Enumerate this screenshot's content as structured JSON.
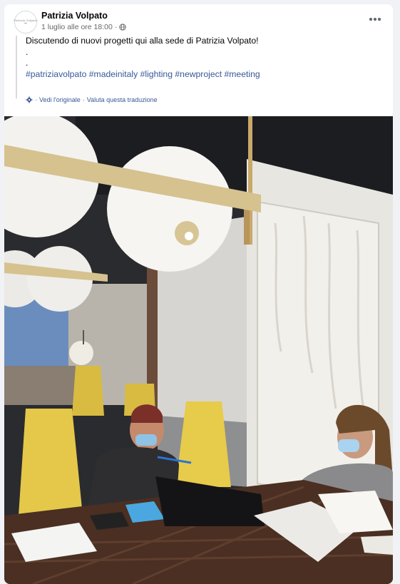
{
  "post": {
    "author": "Patrizia Volpato",
    "avatar_brand": "Patrizia Volpato",
    "timestamp": "1 luglio alle ore 18:00",
    "separator": "·",
    "audience_icon": "globe-icon",
    "more_icon": "more-options-icon",
    "text_lines": [
      "Discutendo di nuovi progetti qui alla sede di Patrizia Volpato!",
      ".",
      "."
    ],
    "hashtags": [
      "#patriziavolpato",
      "#madeinitaly",
      "#lighting",
      "#newproject",
      "#meeting"
    ],
    "translation": {
      "icon": "gear-icon",
      "see_original": "Vedi l'originale",
      "rate": "Valuta questa traduzione",
      "separator": "·"
    }
  },
  "photo": {
    "subject": "meeting-room-photo"
  }
}
